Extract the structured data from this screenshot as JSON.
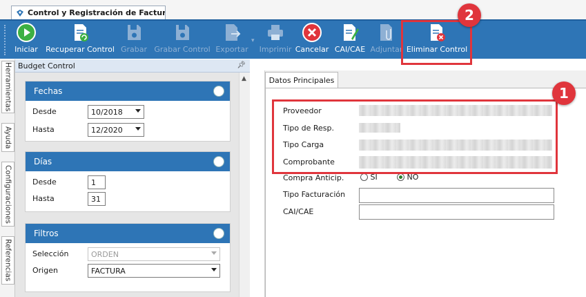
{
  "document_tab": {
    "title": "Control y Registración de Factura..."
  },
  "toolbar": {
    "buttons": [
      {
        "label": "Iniciar",
        "icon": "play-icon",
        "enabled": true
      },
      {
        "label": "Recuperar Control",
        "icon": "recover-document-icon",
        "enabled": true
      },
      {
        "label": "Grabar",
        "icon": "save-icon",
        "enabled": false
      },
      {
        "label": "Grabar Control",
        "icon": "save-control-icon",
        "enabled": false
      },
      {
        "label": "Exportar",
        "icon": "export-icon",
        "enabled": false
      },
      {
        "label": "Imprimir",
        "icon": "printer-icon",
        "enabled": false
      },
      {
        "label": "Cancelar",
        "icon": "cancel-icon",
        "enabled": true
      },
      {
        "label": "CAI/CAE",
        "icon": "edit-document-icon",
        "enabled": true
      },
      {
        "label": "Adjuntar",
        "icon": "attach-icon",
        "enabled": false
      },
      {
        "label": "Eliminar Control",
        "icon": "delete-document-icon",
        "enabled": true
      }
    ]
  },
  "side_tabs": [
    "Herramientas",
    "Ayuda",
    "Configuraciones",
    "Referencias"
  ],
  "panel": {
    "title": "Budget Control",
    "pin": "⊕",
    "fechas": {
      "title": "Fechas",
      "desde_label": "Desde",
      "desde_value": "10/2018",
      "hasta_label": "Hasta",
      "hasta_value": "12/2020"
    },
    "dias": {
      "title": "Días",
      "desde_label": "Desde",
      "desde_value": "1",
      "hasta_label": "Hasta",
      "hasta_value": "31"
    },
    "filtros": {
      "title": "Filtros",
      "seleccion_label": "Selección",
      "seleccion_value": "ORDEN",
      "origen_label": "Origen",
      "origen_value": "FACTURA"
    }
  },
  "main": {
    "tab_label": "Datos Principales",
    "fields": {
      "proveedor": "Proveedor",
      "tipo_resp": "Tipo de Resp.",
      "tipo_carga": "Tipo Carga",
      "comprobante": "Comprobante",
      "compra_anticip": "Compra Anticip.",
      "tipo_facturacion": "Tipo Facturación",
      "cai_cae": "CAI/CAE"
    },
    "radio_si": "SI",
    "radio_no": "NO",
    "radio_selected": "NO"
  },
  "annotations": {
    "badge_1": "1",
    "badge_2": "2"
  },
  "colors": {
    "ribbon": "#2e75b6",
    "highlight": "#e0353c"
  }
}
